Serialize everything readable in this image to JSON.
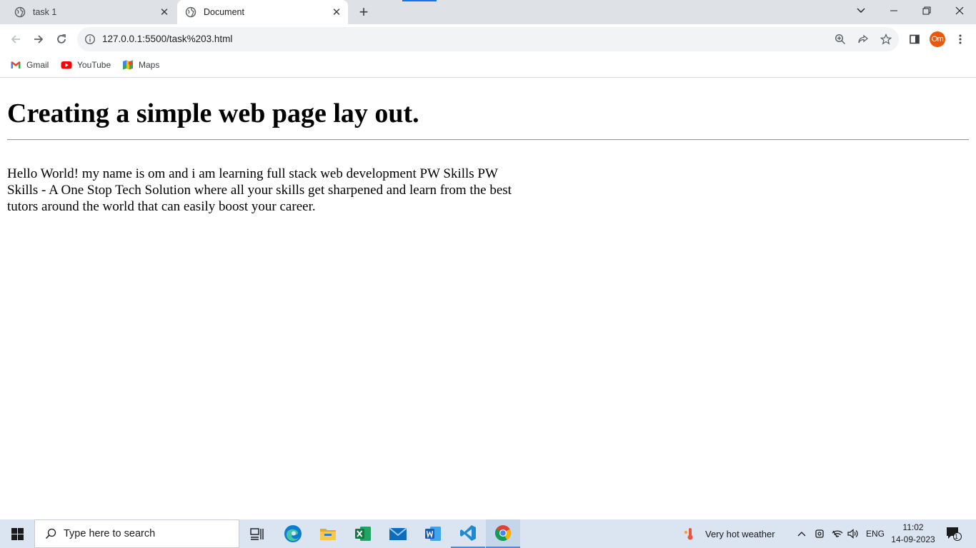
{
  "browser": {
    "tabs": [
      {
        "title": "task 1",
        "active": false
      },
      {
        "title": "Document",
        "active": true
      }
    ],
    "address": "127.0.0.1:5500/task%203.html",
    "profile_initials": "Om",
    "bookmarks": [
      {
        "label": "Gmail",
        "icon": "gmail-icon"
      },
      {
        "label": "YouTube",
        "icon": "youtube-icon"
      },
      {
        "label": "Maps",
        "icon": "maps-icon"
      }
    ]
  },
  "page": {
    "heading": "Creating a simple web page lay out.",
    "paragraph": "Hello World! my name is om and i am learning full stack web development PW Skills PW Skills - A One Stop Tech Solution where all your skills get sharpened and learn from the best tutors around the world that can easily boost your career."
  },
  "taskbar": {
    "search_placeholder": "Type here to search",
    "weather": "Very hot weather",
    "language": "ENG",
    "time": "11:02",
    "date": "14-09-2023",
    "notification_count": "1"
  },
  "colors": {
    "tab_strip": "#dee1e6",
    "omnibox": "#f1f3f4",
    "avatar": "#e8590c",
    "taskbar": "#dbe5f1"
  }
}
